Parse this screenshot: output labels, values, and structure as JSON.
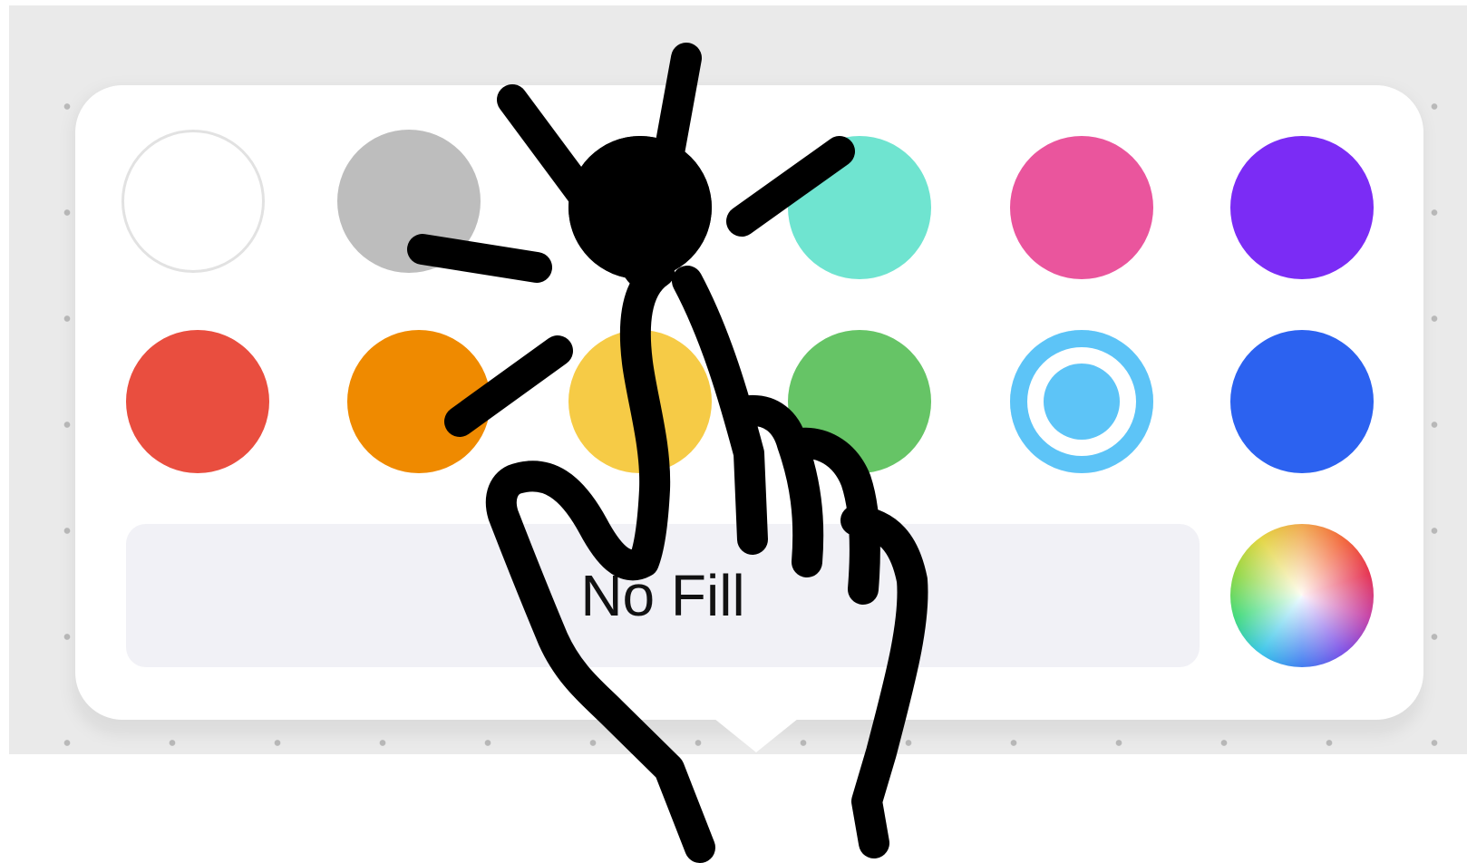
{
  "color_picker": {
    "swatches": [
      {
        "name": "white",
        "color": "#ffffff",
        "row": 1,
        "col": 1
      },
      {
        "name": "gray",
        "color": "#bdbdbd",
        "row": 1,
        "col": 2
      },
      {
        "name": "black",
        "color": "#000000",
        "row": 1,
        "col": 3
      },
      {
        "name": "mint",
        "color": "#6fe4d0",
        "row": 1,
        "col": 4
      },
      {
        "name": "pink",
        "color": "#ea559d",
        "row": 1,
        "col": 5
      },
      {
        "name": "purple",
        "color": "#7b2cf5",
        "row": 1,
        "col": 6
      },
      {
        "name": "red",
        "color": "#e94e3f",
        "row": 2,
        "col": 1
      },
      {
        "name": "orange",
        "color": "#ef8a00",
        "row": 2,
        "col": 2
      },
      {
        "name": "yellow",
        "color": "#f6cb46",
        "row": 2,
        "col": 3
      },
      {
        "name": "green",
        "color": "#66c466",
        "row": 2,
        "col": 4
      },
      {
        "name": "light-blue",
        "color": "#5dc4f7",
        "row": 2,
        "col": 5,
        "selected": true
      },
      {
        "name": "blue",
        "color": "#2c62f0",
        "row": 2,
        "col": 6
      }
    ],
    "no_fill_label": "No Fill",
    "custom_color_icon": "color-wheel-icon"
  },
  "gesture_overlay": {
    "icon": "tap-gesture-hand-icon",
    "target": "black-swatch",
    "color": "#000000"
  }
}
